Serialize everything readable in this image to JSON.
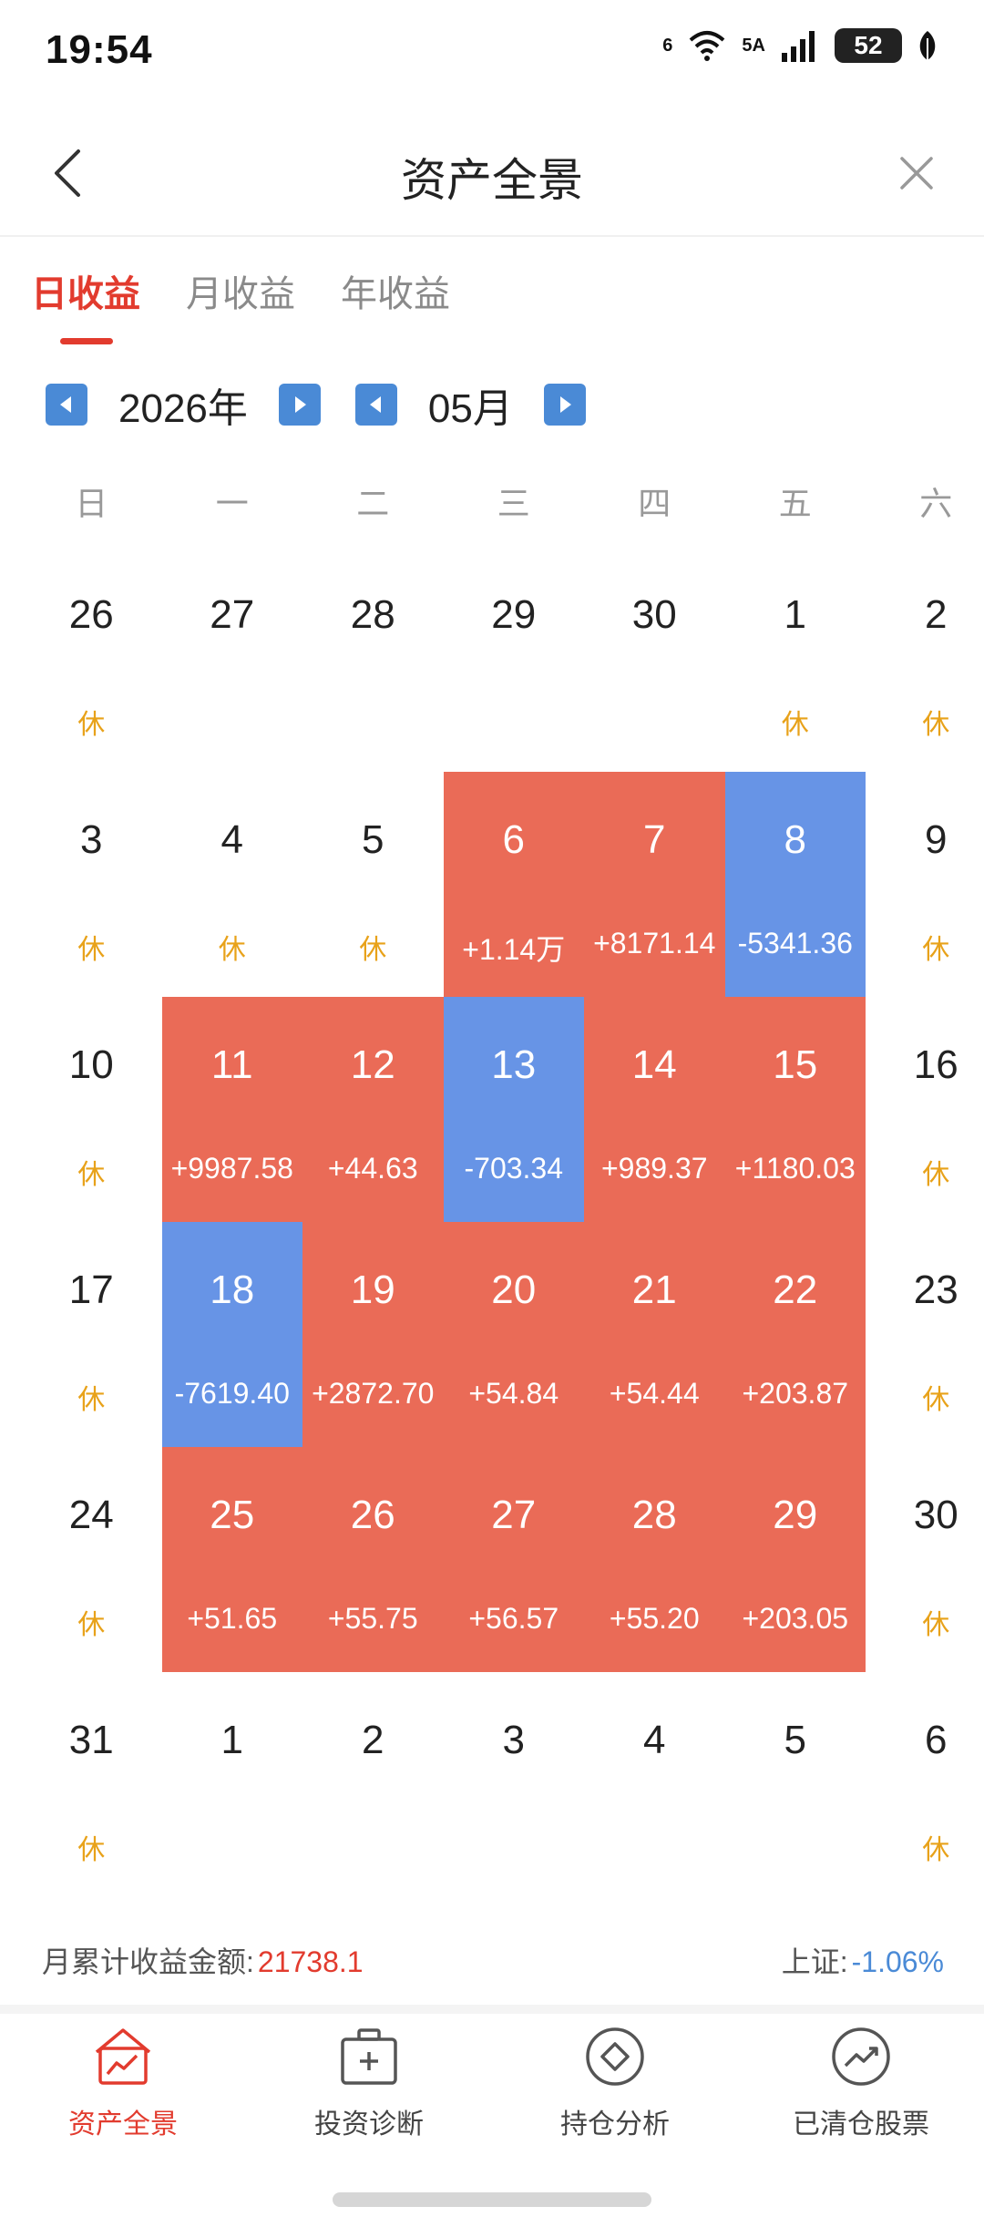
{
  "status": {
    "time": "19:54",
    "net1": "6",
    "net2": "5A",
    "battery": "52"
  },
  "header": {
    "title": "资产全景"
  },
  "tabs": [
    {
      "label": "日收益",
      "active": true
    },
    {
      "label": "月收益",
      "active": false
    },
    {
      "label": "年收益",
      "active": false
    }
  ],
  "datenav": {
    "year": "2026年",
    "month": "05月"
  },
  "weekdays": [
    "日",
    "一",
    "二",
    "三",
    "四",
    "五",
    "六"
  ],
  "rest_label": "休",
  "calendar": [
    {
      "day": "26",
      "sub": "休",
      "type": "rest"
    },
    {
      "day": "27",
      "sub": "",
      "type": "none"
    },
    {
      "day": "28",
      "sub": "",
      "type": "none"
    },
    {
      "day": "29",
      "sub": "",
      "type": "none"
    },
    {
      "day": "30",
      "sub": "",
      "type": "none"
    },
    {
      "day": "1",
      "sub": "休",
      "type": "rest"
    },
    {
      "day": "2",
      "sub": "休",
      "type": "rest"
    },
    {
      "day": "3",
      "sub": "休",
      "type": "rest"
    },
    {
      "day": "4",
      "sub": "休",
      "type": "rest"
    },
    {
      "day": "5",
      "sub": "休",
      "type": "rest"
    },
    {
      "day": "6",
      "sub": "+1.14万",
      "type": "gain"
    },
    {
      "day": "7",
      "sub": "+8171.14",
      "type": "gain"
    },
    {
      "day": "8",
      "sub": "-5341.36",
      "type": "loss"
    },
    {
      "day": "9",
      "sub": "休",
      "type": "rest"
    },
    {
      "day": "10",
      "sub": "休",
      "type": "rest"
    },
    {
      "day": "11",
      "sub": "+9987.58",
      "type": "gain"
    },
    {
      "day": "12",
      "sub": "+44.63",
      "type": "gain"
    },
    {
      "day": "13",
      "sub": "-703.34",
      "type": "loss"
    },
    {
      "day": "14",
      "sub": "+989.37",
      "type": "gain"
    },
    {
      "day": "15",
      "sub": "+1180.03",
      "type": "gain"
    },
    {
      "day": "16",
      "sub": "休",
      "type": "rest"
    },
    {
      "day": "17",
      "sub": "休",
      "type": "rest"
    },
    {
      "day": "18",
      "sub": "-7619.40",
      "type": "loss"
    },
    {
      "day": "19",
      "sub": "+2872.70",
      "type": "gain"
    },
    {
      "day": "20",
      "sub": "+54.84",
      "type": "gain"
    },
    {
      "day": "21",
      "sub": "+54.44",
      "type": "gain"
    },
    {
      "day": "22",
      "sub": "+203.87",
      "type": "gain"
    },
    {
      "day": "23",
      "sub": "休",
      "type": "rest"
    },
    {
      "day": "24",
      "sub": "休",
      "type": "rest"
    },
    {
      "day": "25",
      "sub": "+51.65",
      "type": "gain"
    },
    {
      "day": "26",
      "sub": "+55.75",
      "type": "gain"
    },
    {
      "day": "27",
      "sub": "+56.57",
      "type": "gain"
    },
    {
      "day": "28",
      "sub": "+55.20",
      "type": "gain"
    },
    {
      "day": "29",
      "sub": "+203.05",
      "type": "gain"
    },
    {
      "day": "30",
      "sub": "休",
      "type": "rest"
    },
    {
      "day": "31",
      "sub": "休",
      "type": "rest"
    },
    {
      "day": "1",
      "sub": "",
      "type": "none"
    },
    {
      "day": "2",
      "sub": "",
      "type": "none"
    },
    {
      "day": "3",
      "sub": "",
      "type": "none"
    },
    {
      "day": "4",
      "sub": "",
      "type": "none"
    },
    {
      "day": "5",
      "sub": "",
      "type": "none"
    },
    {
      "day": "6",
      "sub": "休",
      "type": "rest"
    }
  ],
  "summary": {
    "label": "月累计收益金额:",
    "amount": "21738.1",
    "index_label": "上证:",
    "index_value": "-1.06%"
  },
  "bottom_nav": [
    {
      "label": "资产全景",
      "icon": "asset-chart-icon",
      "active": true
    },
    {
      "label": "投资诊断",
      "icon": "medical-kit-icon",
      "active": false
    },
    {
      "label": "持仓分析",
      "icon": "diamond-circle-icon",
      "active": false
    },
    {
      "label": "已清仓股票",
      "icon": "trend-circle-icon",
      "active": false
    }
  ],
  "colors": {
    "accent": "#e23b2e",
    "gain": "#ea6b57",
    "loss": "#6794e6",
    "rest": "#e8a21a",
    "nav_blue": "#4a8ad6"
  }
}
